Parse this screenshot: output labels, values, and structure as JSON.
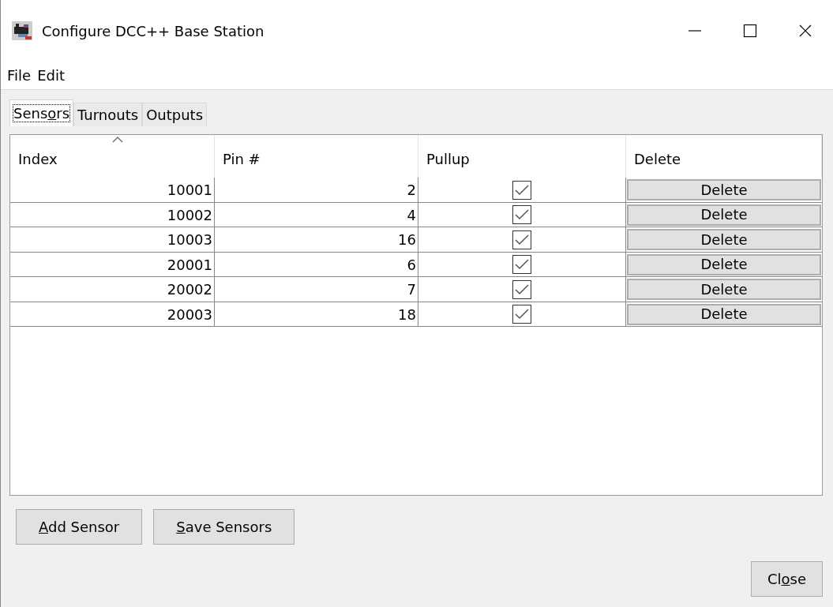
{
  "window": {
    "title": "Configure DCC++ Base Station"
  },
  "menu": [
    "File",
    "Edit"
  ],
  "tabs": [
    {
      "label": {
        "before": "Sens",
        "key": "o",
        "after": "rs"
      },
      "selected": true
    },
    {
      "label": {
        "before": "Turnouts"
      },
      "selected": false
    },
    {
      "label": {
        "before": "Outputs"
      },
      "selected": false
    }
  ],
  "table": {
    "columns": [
      {
        "label": "Index",
        "sorted": true
      },
      {
        "label": "Pin #",
        "sorted": false
      },
      {
        "label": "Pullup",
        "sorted": false
      },
      {
        "label": "Delete",
        "sorted": false
      }
    ],
    "rows": [
      {
        "index": "10001",
        "pin": "2",
        "pullup": true,
        "action": "Delete"
      },
      {
        "index": "10002",
        "pin": "4",
        "pullup": true,
        "action": "Delete"
      },
      {
        "index": "10003",
        "pin": "16",
        "pullup": true,
        "action": "Delete"
      },
      {
        "index": "20001",
        "pin": "6",
        "pullup": true,
        "action": "Delete"
      },
      {
        "index": "20002",
        "pin": "7",
        "pullup": true,
        "action": "Delete"
      },
      {
        "index": "20003",
        "pin": "18",
        "pullup": true,
        "action": "Delete"
      }
    ]
  },
  "buttons": [
    {
      "label": {
        "key": "A",
        "after": "dd Sensor"
      }
    },
    {
      "label": {
        "key": "S",
        "after": "ave Sensors"
      }
    }
  ],
  "close_button": {
    "label": {
      "before": "Cl",
      "key": "o",
      "after": "se"
    }
  }
}
